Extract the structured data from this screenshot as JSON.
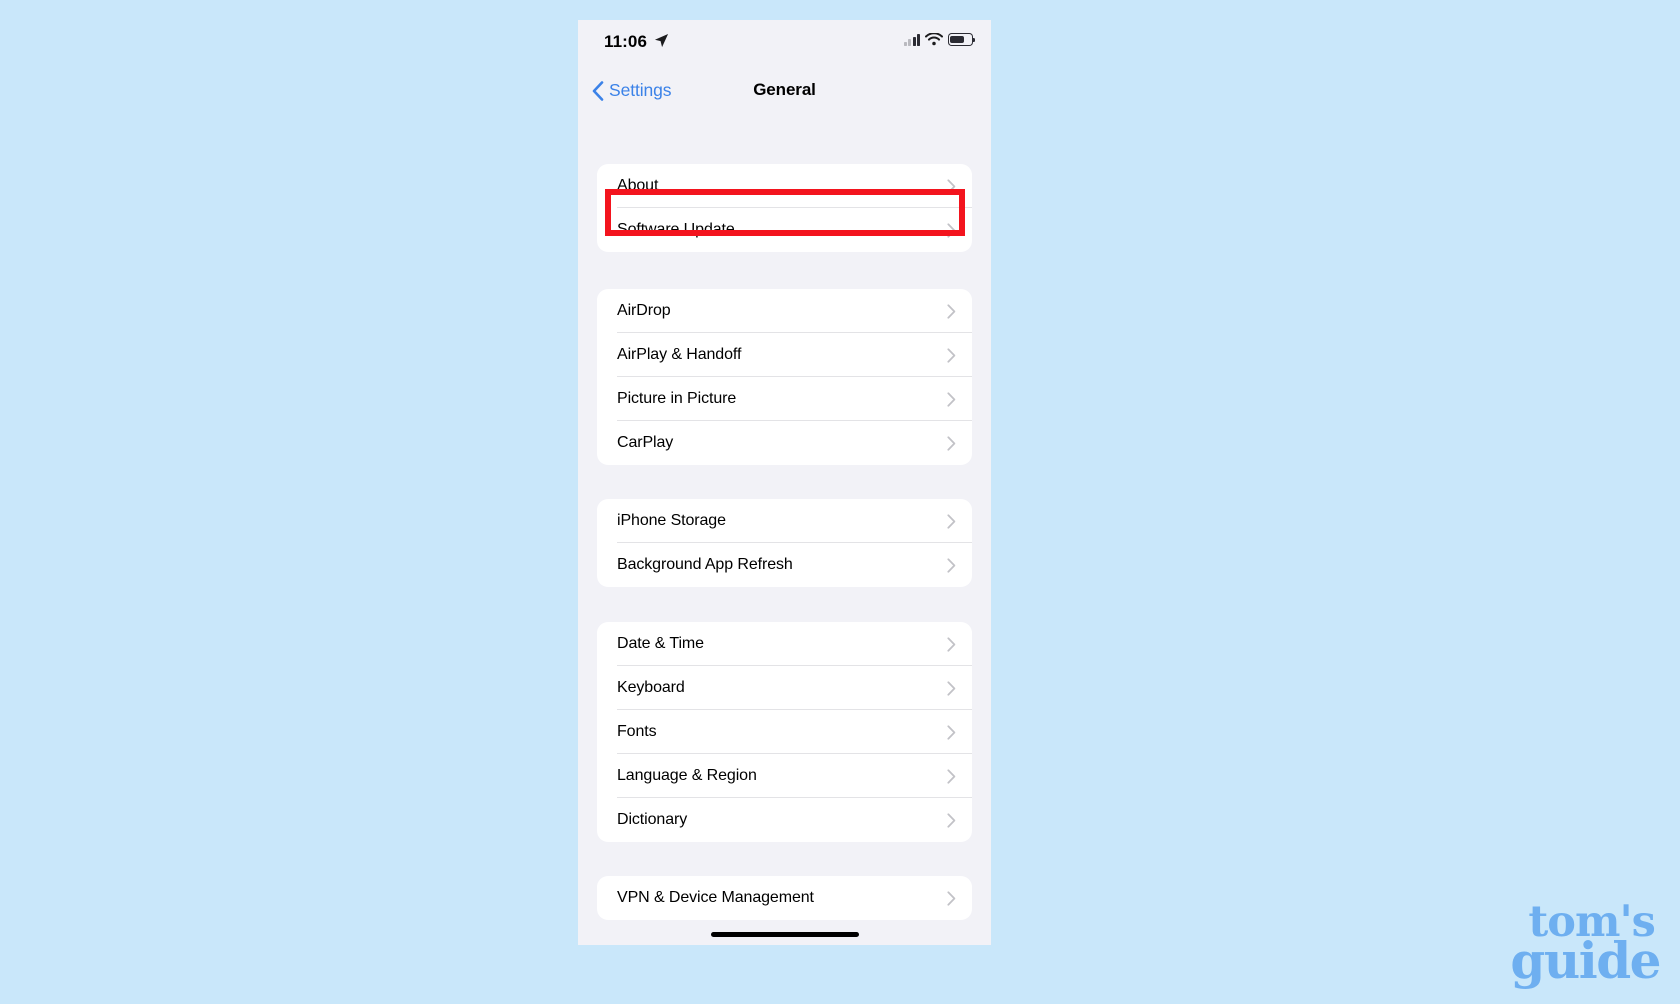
{
  "page": {
    "background_color": "#c9e7fa",
    "watermark": {
      "line1": "tom's",
      "line2": "guide",
      "color": "#6eaff0"
    }
  },
  "status_bar": {
    "time": "11:06",
    "location_icon": "location-arrow-icon",
    "cellular_icon": "cellular-signal-icon",
    "cellular_bars_filled": 2,
    "cellular_bars_total": 4,
    "wifi_icon": "wifi-icon",
    "battery_icon": "battery-icon",
    "battery_level_percent": 62
  },
  "nav_bar": {
    "back_label": "Settings",
    "back_icon": "chevron-left-icon",
    "title": "General"
  },
  "highlight": {
    "color": "#f3141e",
    "target_row": "Software Update"
  },
  "groups": [
    {
      "name": "device-info-group",
      "rows": [
        {
          "label": "About",
          "chevron": "chevron-right-icon"
        },
        {
          "label": "Software Update",
          "chevron": "chevron-right-icon",
          "highlighted": true
        }
      ]
    },
    {
      "name": "connectivity-group",
      "rows": [
        {
          "label": "AirDrop",
          "chevron": "chevron-right-icon"
        },
        {
          "label": "AirPlay & Handoff",
          "chevron": "chevron-right-icon"
        },
        {
          "label": "Picture in Picture",
          "chevron": "chevron-right-icon"
        },
        {
          "label": "CarPlay",
          "chevron": "chevron-right-icon"
        }
      ]
    },
    {
      "name": "storage-group",
      "rows": [
        {
          "label": "iPhone Storage",
          "chevron": "chevron-right-icon"
        },
        {
          "label": "Background App Refresh",
          "chevron": "chevron-right-icon"
        }
      ]
    },
    {
      "name": "localization-group",
      "rows": [
        {
          "label": "Date & Time",
          "chevron": "chevron-right-icon"
        },
        {
          "label": "Keyboard",
          "chevron": "chevron-right-icon"
        },
        {
          "label": "Fonts",
          "chevron": "chevron-right-icon"
        },
        {
          "label": "Language & Region",
          "chevron": "chevron-right-icon"
        },
        {
          "label": "Dictionary",
          "chevron": "chevron-right-icon"
        }
      ]
    },
    {
      "name": "management-group",
      "rows": [
        {
          "label": "VPN & Device Management",
          "chevron": "chevron-right-icon"
        }
      ]
    }
  ]
}
